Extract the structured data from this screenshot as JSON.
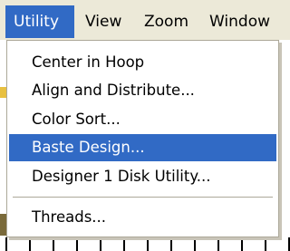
{
  "menubar": {
    "items": [
      {
        "label": "Utility",
        "active": true
      },
      {
        "label": "View",
        "active": false
      },
      {
        "label": "Zoom",
        "active": false
      },
      {
        "label": "Window",
        "active": false
      }
    ]
  },
  "utility_menu": {
    "items": [
      {
        "label": "Center in Hoop",
        "highlighted": false
      },
      {
        "label": "Align and Distribute...",
        "highlighted": false
      },
      {
        "label": "Color Sort...",
        "highlighted": false
      },
      {
        "label": "Baste Design...",
        "highlighted": true
      },
      {
        "label": "Designer 1 Disk Utility...",
        "highlighted": false
      },
      {
        "label": "Threads...",
        "highlighted": false
      }
    ]
  },
  "colors": {
    "menu_highlight": "#316ac5",
    "menubar_bg": "#ece9d8",
    "separator": "#aca899"
  }
}
